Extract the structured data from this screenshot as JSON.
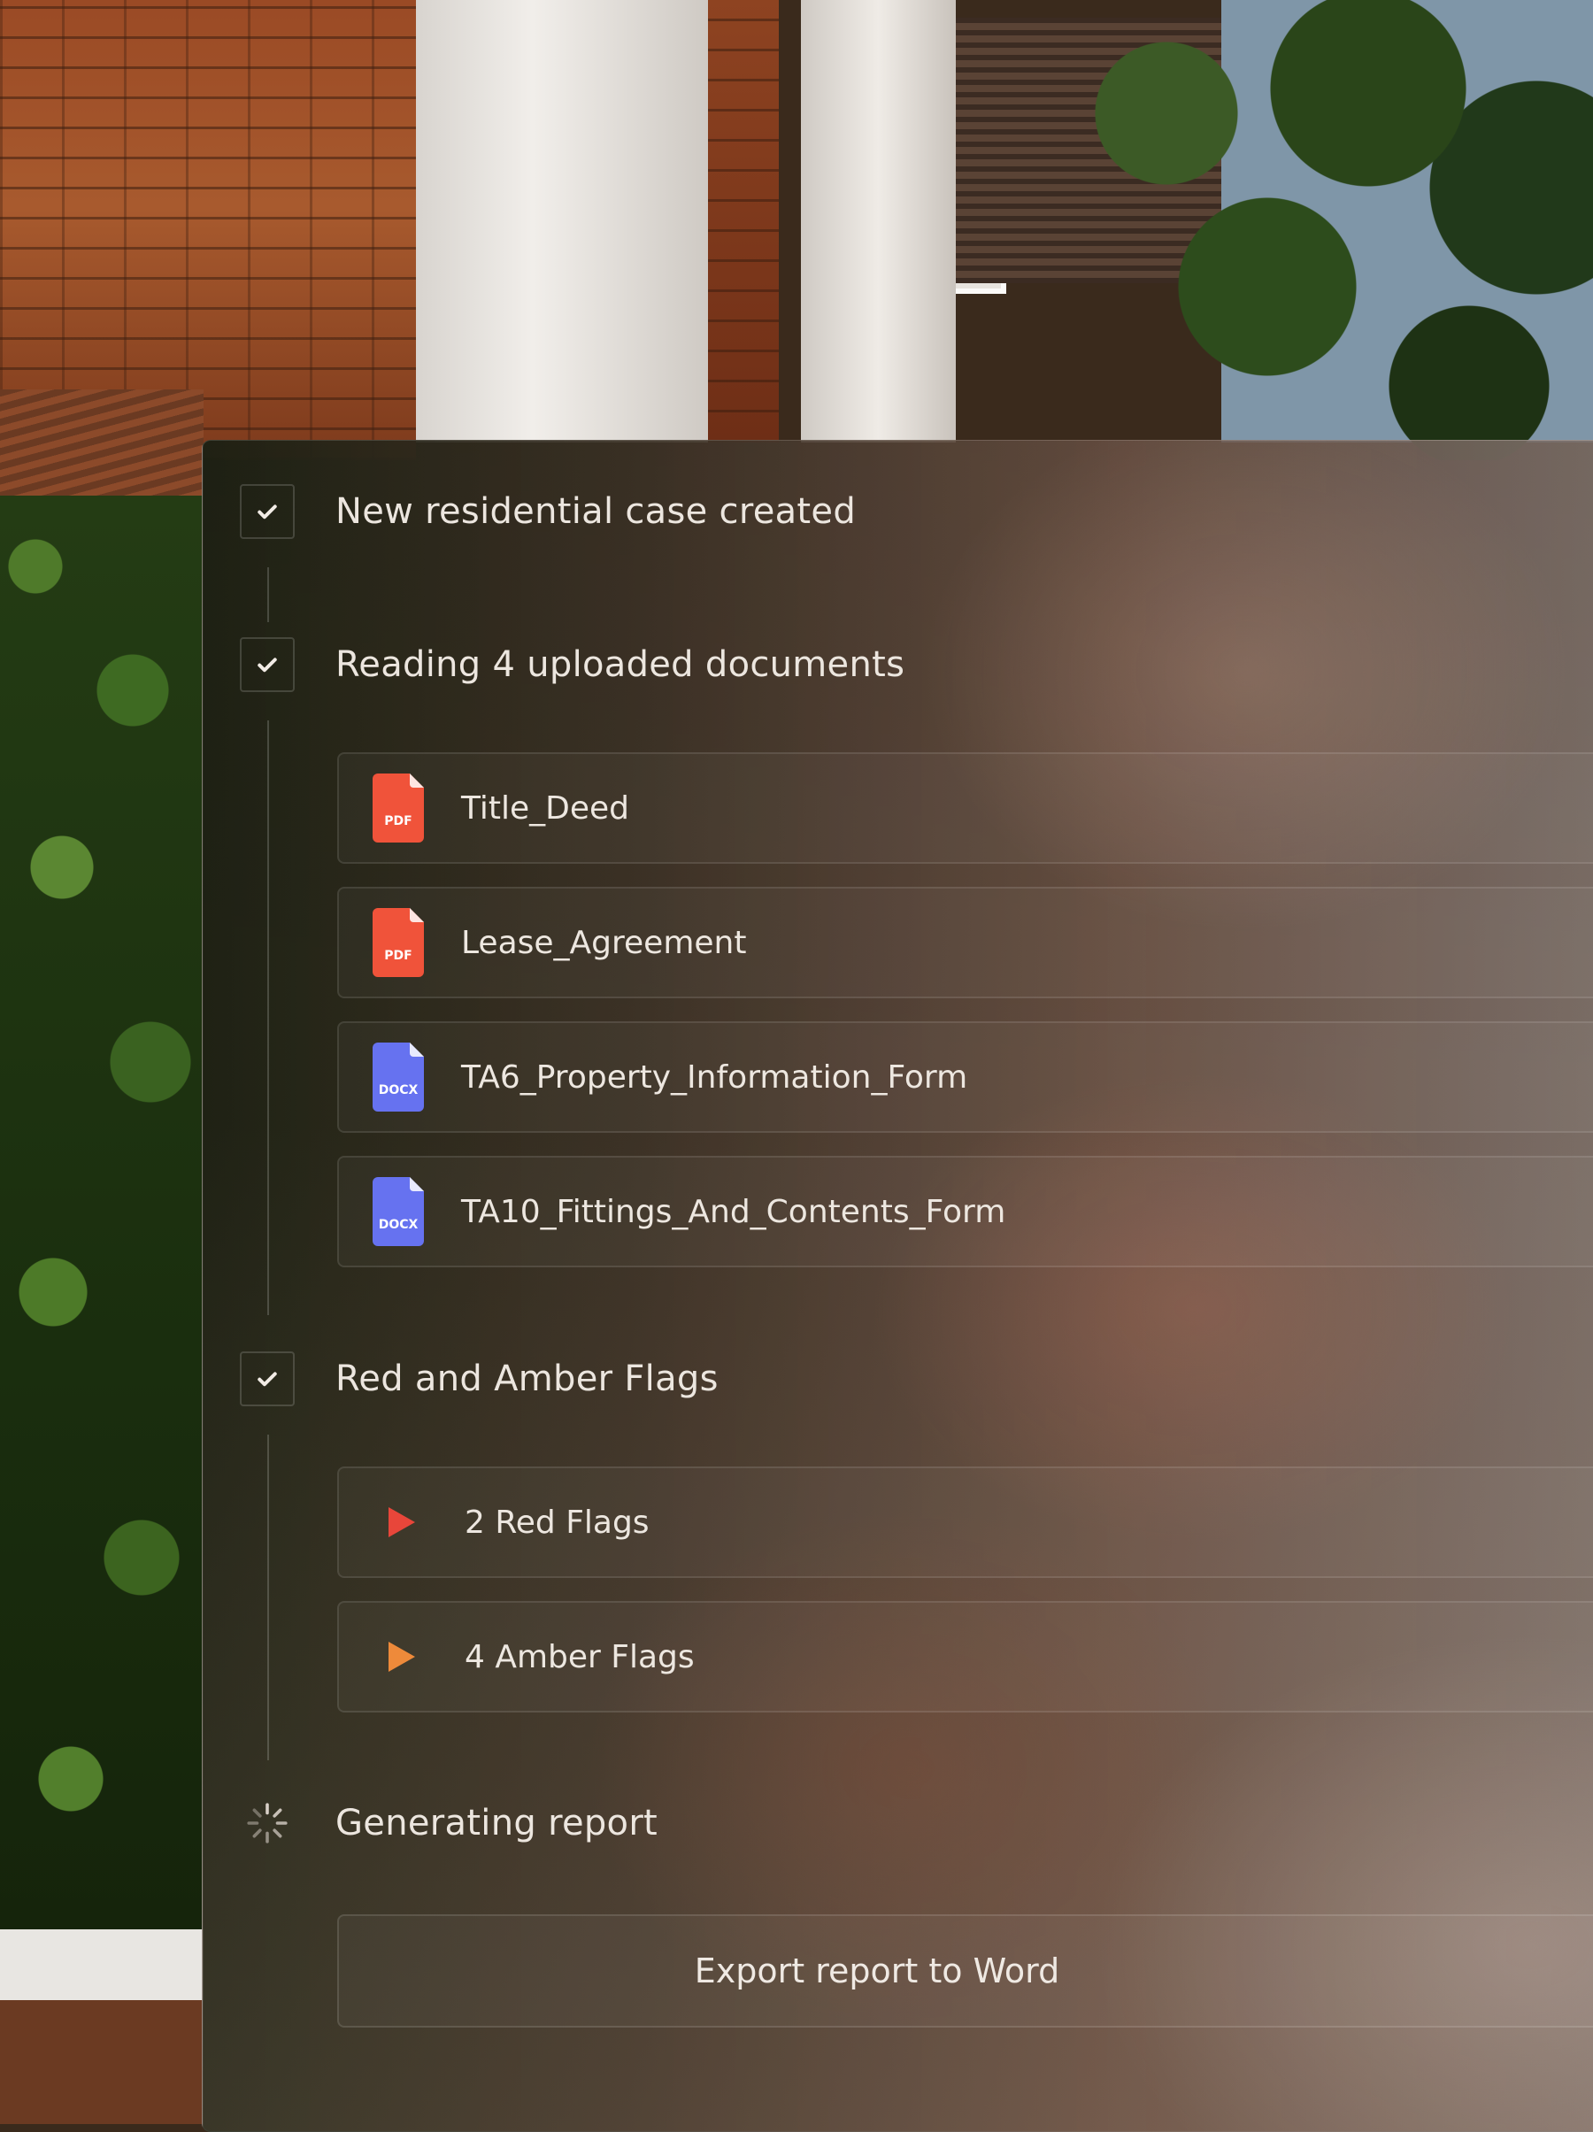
{
  "steps": {
    "case_created": {
      "label": "New residential case created",
      "status": "done"
    },
    "reading_docs": {
      "label": "Reading 4 uploaded documents",
      "status": "done"
    },
    "flags": {
      "label": "Red and Amber Flags",
      "status": "done"
    },
    "generating": {
      "label": "Generating report",
      "status": "in-progress"
    }
  },
  "documents": [
    {
      "name": "Title_Deed",
      "type": "PDF",
      "icon": "pdf-file-icon",
      "color": "#f0533a"
    },
    {
      "name": "Lease_Agreement",
      "type": "PDF",
      "icon": "pdf-file-icon",
      "color": "#f0533a"
    },
    {
      "name": "TA6_Property_Information_Form",
      "type": "DOCX",
      "icon": "docx-file-icon",
      "color": "#6672f0"
    },
    {
      "name": "TA10_Fittings_And_Contents_Form",
      "type": "DOCX",
      "icon": "docx-file-icon",
      "color": "#6672f0"
    }
  ],
  "flags": [
    {
      "label": "2 Red Flags",
      "icon": "play-triangle-icon",
      "color": "#e8463a"
    },
    {
      "label": "4 Amber Flags",
      "icon": "play-triangle-icon",
      "color": "#ee8a3a"
    }
  ],
  "export_button": {
    "label": "Export report to Word"
  }
}
